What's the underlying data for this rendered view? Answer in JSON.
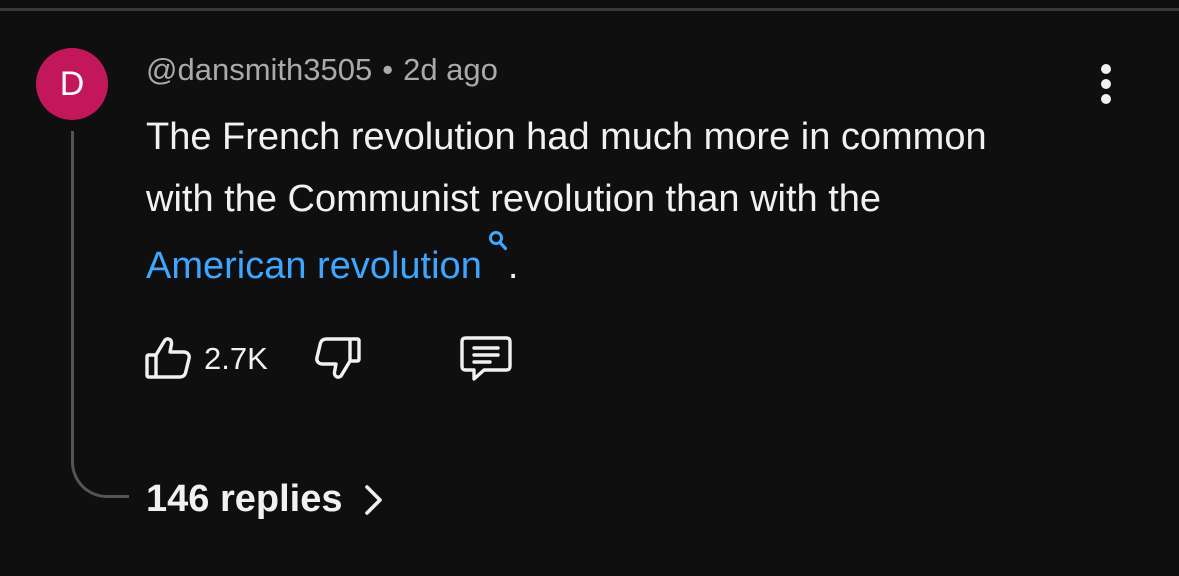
{
  "comment": {
    "avatar_letter": "D",
    "avatar_color": "#c2185b",
    "author": "@dansmith3505",
    "separator": "•",
    "time": "2d ago",
    "text_before": "The French revolution had much more in common with the Communist revolution than with the ",
    "search_link": "American revolution",
    "text_after": ".",
    "like_count": "2.7K",
    "replies_label": "146 replies"
  },
  "icons": {
    "like": "thumbs-up-icon",
    "dislike": "thumbs-down-icon",
    "reply": "comment-icon",
    "menu": "more-vert-icon",
    "search": "search-icon",
    "chevron": "chevron-right-icon"
  },
  "colors": {
    "background": "#0f0f0f",
    "text": "#f1f1f1",
    "secondary_text": "#aaaaaa",
    "link": "#3ea6ff"
  }
}
